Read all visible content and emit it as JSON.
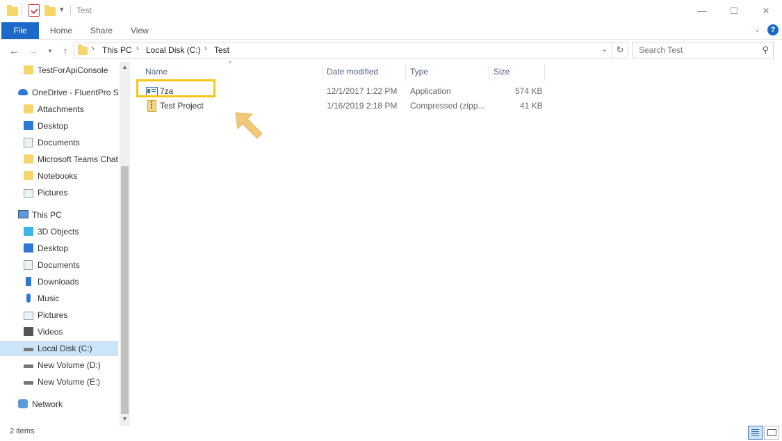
{
  "window": {
    "title": "Test",
    "controls": {
      "minimize": "—",
      "maximize": "☐",
      "close": "✕"
    }
  },
  "ribbon": {
    "tabs": [
      "File",
      "Home",
      "Share",
      "View"
    ]
  },
  "address": {
    "crumbs": [
      "This PC",
      "Local Disk (C:)",
      "Test"
    ]
  },
  "search": {
    "placeholder": "Search Test"
  },
  "sidebar": {
    "items": [
      {
        "label": "TestForApiConsole",
        "icon": "folder-icon",
        "indent": 1
      },
      {
        "label": "OneDrive - FluentPro Sc",
        "icon": "cloud-icon",
        "indent": 0
      },
      {
        "label": "Attachments",
        "icon": "folder-icon",
        "indent": 1
      },
      {
        "label": "Desktop",
        "icon": "desktop-icon",
        "indent": 1
      },
      {
        "label": "Documents",
        "icon": "documents-icon",
        "indent": 1
      },
      {
        "label": "Microsoft Teams Chat",
        "icon": "folder-icon",
        "indent": 1
      },
      {
        "label": "Notebooks",
        "icon": "folder-icon",
        "indent": 1
      },
      {
        "label": "Pictures",
        "icon": "pictures-icon",
        "indent": 1
      },
      {
        "label": "This PC",
        "icon": "computer-icon",
        "indent": 0
      },
      {
        "label": "3D Objects",
        "icon": "cube-icon",
        "indent": 1
      },
      {
        "label": "Desktop",
        "icon": "desktop-icon",
        "indent": 1
      },
      {
        "label": "Documents",
        "icon": "documents-icon",
        "indent": 1
      },
      {
        "label": "Downloads",
        "icon": "download-icon",
        "indent": 1
      },
      {
        "label": "Music",
        "icon": "music-icon",
        "indent": 1
      },
      {
        "label": "Pictures",
        "icon": "pictures-icon",
        "indent": 1
      },
      {
        "label": "Videos",
        "icon": "video-icon",
        "indent": 1
      },
      {
        "label": "Local Disk (C:)",
        "icon": "drive-icon",
        "indent": 1,
        "selected": true
      },
      {
        "label": "New Volume (D:)",
        "icon": "drive-icon",
        "indent": 1
      },
      {
        "label": "New Volume (E:)",
        "icon": "drive-icon",
        "indent": 1
      },
      {
        "label": "Network",
        "icon": "network-icon",
        "indent": 0
      }
    ]
  },
  "columns": {
    "name": "Name",
    "date": "Date modified",
    "type": "Type",
    "size": "Size"
  },
  "files": [
    {
      "name": "7za",
      "date": "12/1/2017 1:22 PM",
      "type": "Application",
      "size": "574 KB",
      "icon": "application-icon"
    },
    {
      "name": "Test Project",
      "date": "1/16/2019 2:18 PM",
      "type": "Compressed (zipp...",
      "size": "41 KB",
      "icon": "zip-folder-icon"
    }
  ],
  "status": {
    "item_count": "2 items"
  },
  "colors": {
    "accent": "#1b6ac9",
    "highlight_box": "#f5c518",
    "annotation_arrow": "#f0c878",
    "selected": "#cce4f7"
  }
}
